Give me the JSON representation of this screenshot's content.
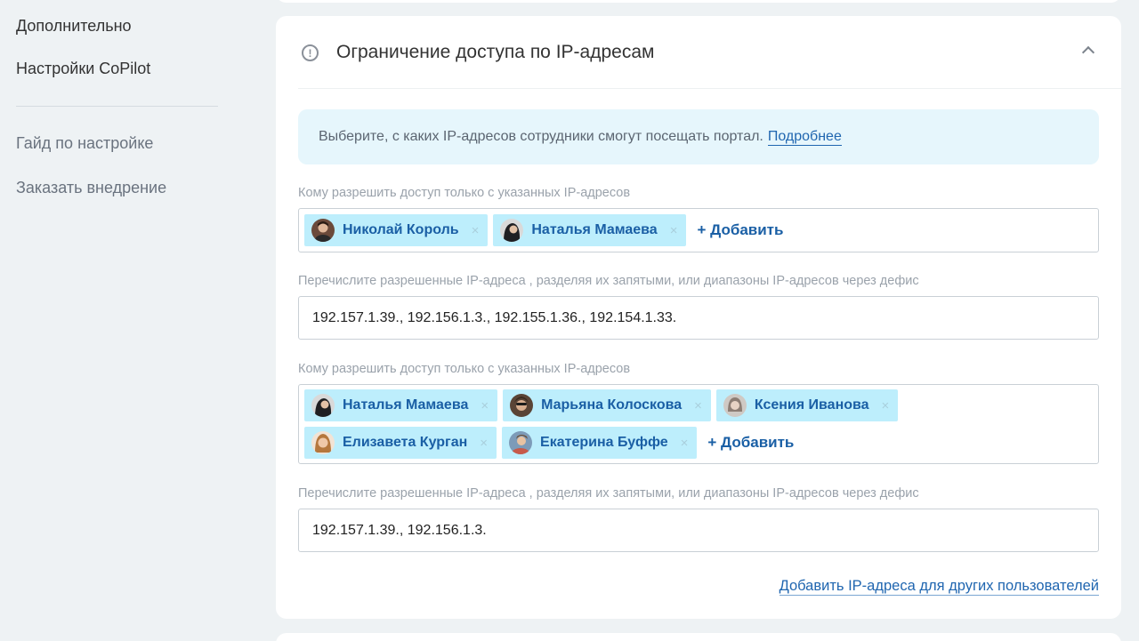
{
  "sidebar": {
    "items": [
      {
        "label": "Дополнительно"
      },
      {
        "label": "Настройки CoPilot"
      },
      {
        "label": "Гайд по настройке"
      },
      {
        "label": "Заказать внедрение"
      }
    ]
  },
  "section": {
    "title": "Ограничение доступа по IP-адресам",
    "info_text": "Выберите, с каких IP-адресов сотрудники смогут посещать портал.",
    "info_link": "Подробнее",
    "groups": [
      {
        "users_label": "Кому разрешить доступ только с указанных IP-адресов",
        "users": [
          {
            "name": "Николай Король",
            "avatar_color": "#6b4a3a"
          },
          {
            "name": "Наталья Мамаева",
            "avatar_color": "#2b2b30"
          }
        ],
        "add_label": "+ Добавить",
        "ip_label": "Перечислите разрешенные IP-адреса , разделяя их запятыми, или диапазоны IP-адресов через дефис",
        "ip_value": "192.157.1.39., 192.156.1.3.,  192.155.1.36., 192.154.1.33."
      },
      {
        "users_label": "Кому разрешить доступ только с указанных IP-адресов",
        "users": [
          {
            "name": "Наталья Мамаева",
            "avatar_color": "#2b2b30"
          },
          {
            "name": "Марьяна Колоскова",
            "avatar_color": "#5a4436"
          },
          {
            "name": "Ксения Иванова",
            "avatar_color": "#9a8e88"
          },
          {
            "name": "Елизавета Курган",
            "avatar_color": "#b5773d"
          },
          {
            "name": "Екатерина Буффе",
            "avatar_color": "#7d9bb8"
          }
        ],
        "add_label": "+ Добавить",
        "ip_label": "Перечислите разрешенные IP-адреса , разделяя их запятыми, или диапазоны IP-адресов через дефис",
        "ip_value": "192.157.1.39., 192.156.1.3."
      }
    ],
    "add_ip_link": "Добавить IP-адреса для других пользователей",
    "remove_glyph": "×"
  },
  "colors": {
    "accent": "#1a5fa5",
    "tag_bg": "#bdeefc",
    "info_bg": "#e6f6fc",
    "page_bg": "#eef2f4"
  }
}
